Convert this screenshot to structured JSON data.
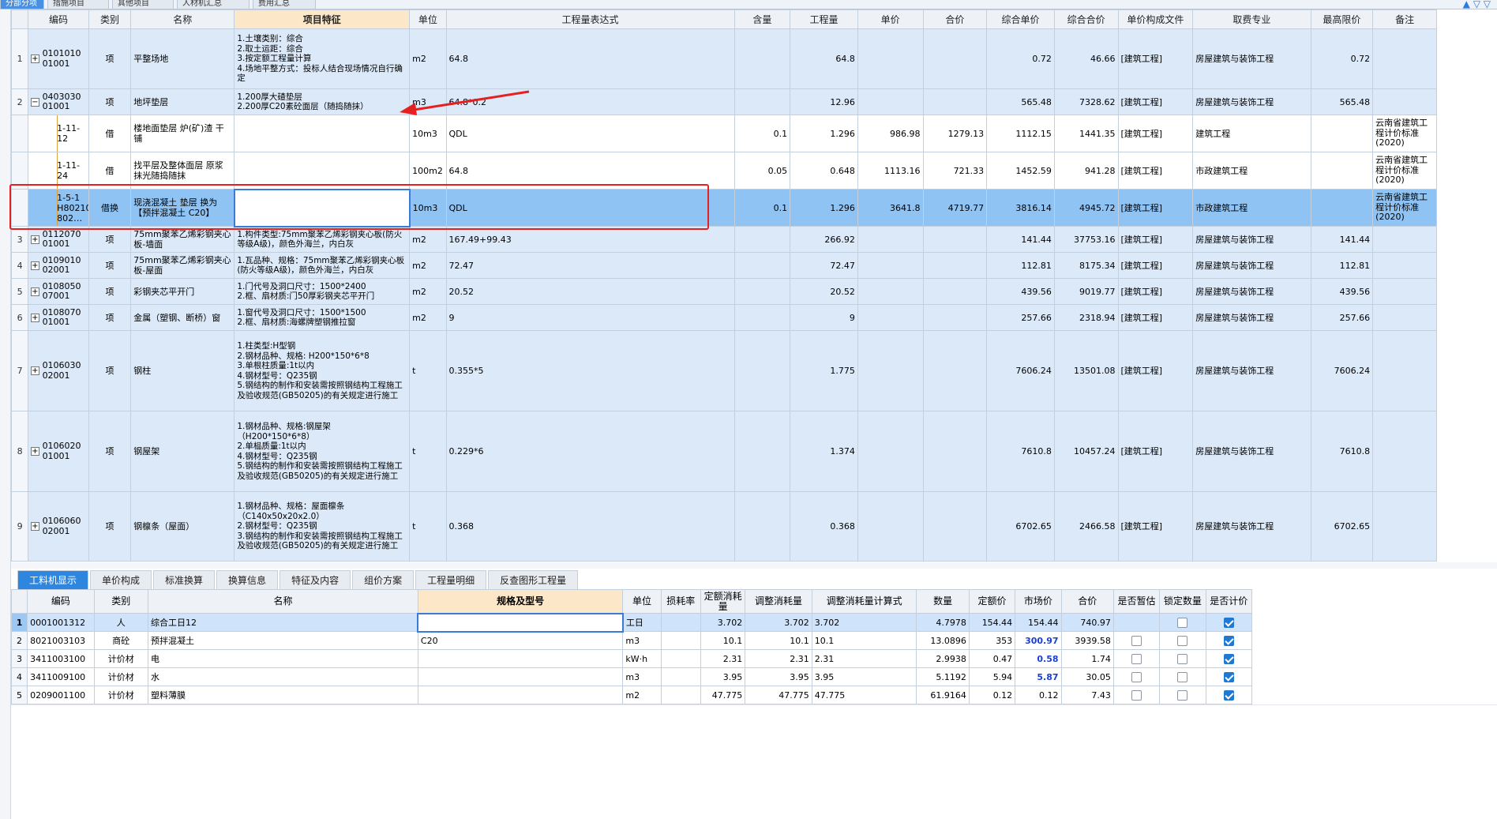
{
  "top_tabs": [
    "分部分项",
    "措施项目",
    "其他项目",
    "人材机汇总",
    "费用汇总"
  ],
  "main_headers": [
    "编码",
    "类别",
    "名称",
    "项目特征",
    "单位",
    "工程量表达式",
    "含量",
    "工程量",
    "单价",
    "合价",
    "综合单价",
    "综合合价",
    "单价构成文件",
    "取费专业",
    "最高限价",
    "备注"
  ],
  "main_rows": [
    {
      "idx": "1",
      "expander": "+",
      "code": "010101001001",
      "type": "项",
      "name": "平整场地",
      "feature": "1.土壤类别：综合\n2.取土运距：综合\n3.按定额工程量计算\n4.场地平整方式：投标人结合现场情况自行确定",
      "unit": "m2",
      "expr": "64.8",
      "content": "",
      "qty": "64.8",
      "uprice": "",
      "total": "",
      "cuprice": "0.72",
      "ctotal": "46.66",
      "file": "[建筑工程]",
      "major": "房屋建筑与装饰工程",
      "maxprice": "0.72",
      "note": ""
    },
    {
      "idx": "2",
      "expander": "−",
      "code": "040303001001",
      "type": "项",
      "name": "地坪垫层",
      "feature": "1.200厚大碴垫层\n2.200厚C20素砼面层（随捣随抹）",
      "unit": "m3",
      "expr": "64.8*0.2",
      "content": "",
      "qty": "12.96",
      "uprice": "",
      "total": "",
      "cuprice": "565.48",
      "ctotal": "7328.62",
      "file": "[建筑工程]",
      "major": "房屋建筑与装饰工程",
      "maxprice": "565.48",
      "note": ""
    },
    {
      "idx": "",
      "expander": "",
      "code": "1-11-12",
      "type": "借",
      "name": "楼地面垫层 炉(矿)渣 干铺",
      "feature": "",
      "unit": "10m3",
      "expr": "QDL",
      "content": "0.1",
      "qty": "1.296",
      "uprice": "986.98",
      "total": "1279.13",
      "cuprice": "1112.15",
      "ctotal": "1441.35",
      "file": "[建筑工程]",
      "major": "建筑工程",
      "maxprice": "",
      "note": "云南省建筑工程计价标准(2020)"
    },
    {
      "idx": "",
      "expander": "",
      "code": "1-11-24",
      "type": "借",
      "name": "找平层及整体面层 原浆抹光随捣随抹",
      "feature": "",
      "unit": "100m2",
      "expr": "64.8",
      "content": "0.05",
      "qty": "0.648",
      "uprice": "1113.16",
      "total": "721.33",
      "cuprice": "1452.59",
      "ctotal": "941.28",
      "file": "[建筑工程]",
      "major": "市政建筑工程",
      "maxprice": "",
      "note": "云南省建筑工程计价标准(2020)"
    },
    {
      "idx": "",
      "expander": "",
      "code": "1-5-1 H8021003102 802…",
      "type": "借换",
      "name": "现浇混凝土 垫层  换为【预拌混凝土 C20】",
      "feature": "",
      "unit": "10m3",
      "expr": "QDL",
      "content": "0.1",
      "qty": "1.296",
      "uprice": "3641.8",
      "total": "4719.77",
      "cuprice": "3816.14",
      "ctotal": "4945.72",
      "file": "[建筑工程]",
      "major": "市政建筑工程",
      "maxprice": "",
      "note": "云南省建筑工程计价标准(2020)"
    },
    {
      "idx": "3",
      "expander": "+",
      "code": "011207001001",
      "type": "项",
      "name": "75mm聚苯乙烯彩钢夹心板-墙面",
      "feature": "1.构件类型:75mm聚苯乙烯彩钢夹心板(防火等级A级)，颜色外海兰，内白灰",
      "unit": "m2",
      "expr": "167.49+99.43",
      "content": "",
      "qty": "266.92",
      "uprice": "",
      "total": "",
      "cuprice": "141.44",
      "ctotal": "37753.16",
      "file": "[建筑工程]",
      "major": "房屋建筑与装饰工程",
      "maxprice": "141.44",
      "note": ""
    },
    {
      "idx": "4",
      "expander": "+",
      "code": "010901002001",
      "type": "项",
      "name": "75mm聚苯乙烯彩钢夹心板-屋面",
      "feature": "1.瓦品种、规格：75mm聚苯乙烯彩钢夹心板(防火等级A级)，颜色外海兰，内白灰",
      "unit": "m2",
      "expr": "72.47",
      "content": "",
      "qty": "72.47",
      "uprice": "",
      "total": "",
      "cuprice": "112.81",
      "ctotal": "8175.34",
      "file": "[建筑工程]",
      "major": "房屋建筑与装饰工程",
      "maxprice": "112.81",
      "note": ""
    },
    {
      "idx": "5",
      "expander": "+",
      "code": "010805007001",
      "type": "项",
      "name": "彩钢夹芯平开门",
      "feature": "1.门代号及洞口尺寸：1500*2400\n2.框、扇材质:门50厚彩钢夹芯平开门",
      "unit": "m2",
      "expr": "20.52",
      "content": "",
      "qty": "20.52",
      "uprice": "",
      "total": "",
      "cuprice": "439.56",
      "ctotal": "9019.77",
      "file": "[建筑工程]",
      "major": "房屋建筑与装饰工程",
      "maxprice": "439.56",
      "note": ""
    },
    {
      "idx": "6",
      "expander": "+",
      "code": "010807001001",
      "type": "项",
      "name": "金属（塑钢、断桥）窗",
      "feature": "1.窗代号及洞口尺寸：1500*1500\n2.框、扇材质:海螺牌塑钢推拉窗",
      "unit": "m2",
      "expr": "9",
      "content": "",
      "qty": "9",
      "uprice": "",
      "total": "",
      "cuprice": "257.66",
      "ctotal": "2318.94",
      "file": "[建筑工程]",
      "major": "房屋建筑与装饰工程",
      "maxprice": "257.66",
      "note": ""
    },
    {
      "idx": "7",
      "expander": "+",
      "code": "010603002001",
      "type": "项",
      "name": "钢柱",
      "feature": "1.柱类型:H型钢\n2.钢材品种、规格: H200*150*6*8\n3.单根柱质量:1t以内\n4.钢材型号：Q235钢\n5.钢结构的制作和安装需按照钢结构工程施工及验收规范(GB50205)的有关规定进行施工",
      "unit": "t",
      "expr": "0.355*5",
      "content": "",
      "qty": "1.775",
      "uprice": "",
      "total": "",
      "cuprice": "7606.24",
      "ctotal": "13501.08",
      "file": "[建筑工程]",
      "major": "房屋建筑与装饰工程",
      "maxprice": "7606.24",
      "note": ""
    },
    {
      "idx": "8",
      "expander": "+",
      "code": "010602001001",
      "type": "项",
      "name": "钢屋架",
      "feature": "1.钢材品种、规格:钢屋架（H200*150*6*8）\n2.单榀质量:1t以内\n4.钢材型号：Q235钢\n5.钢结构的制作和安装需按照钢结构工程施工及验收规范(GB50205)的有关规定进行施工",
      "unit": "t",
      "expr": "0.229*6",
      "content": "",
      "qty": "1.374",
      "uprice": "",
      "total": "",
      "cuprice": "7610.8",
      "ctotal": "10457.24",
      "file": "[建筑工程]",
      "major": "房屋建筑与装饰工程",
      "maxprice": "7610.8",
      "note": ""
    },
    {
      "idx": "9",
      "expander": "+",
      "code": "010606002001",
      "type": "项",
      "name": "钢檩条（屋面）",
      "feature": "1.钢材品种、规格：屋面檩条（C140x50x20x2.0）\n2.钢材型号：Q235钢\n3.钢结构的制作和安装需按照钢结构工程施工及验收规范(GB50205)的有关规定进行施工",
      "unit": "t",
      "expr": "0.368",
      "content": "",
      "qty": "0.368",
      "uprice": "",
      "total": "",
      "cuprice": "6702.65",
      "ctotal": "2466.58",
      "file": "[建筑工程]",
      "major": "房屋建筑与装饰工程",
      "maxprice": "6702.65",
      "note": ""
    }
  ],
  "bottom_tabs": [
    "工料机显示",
    "单价构成",
    "标准换算",
    "换算信息",
    "特征及内容",
    "组价方案",
    "工程量明细",
    "反查图形工程量"
  ],
  "bottom_headers": [
    "编码",
    "类别",
    "名称",
    "规格及型号",
    "单位",
    "损耗率",
    "定额消耗量",
    "调整消耗量",
    "调整消耗量计算式",
    "数量",
    "定额价",
    "市场价",
    "合价",
    "是否暂估",
    "锁定数量",
    "是否计价"
  ],
  "bottom_rows": [
    {
      "idx": "1",
      "code": "0001001312",
      "type": "人",
      "name": "综合工日12",
      "spec": "",
      "unit": "工日",
      "loss": "",
      "quota": "3.702",
      "adj": "3.702",
      "formula": "3.702",
      "qty": "4.7978",
      "qprice": "154.44",
      "mprice": "154.44",
      "total": "740.97"
    },
    {
      "idx": "2",
      "code": "8021003103",
      "type": "商砼",
      "name": "预拌混凝土",
      "spec": "C20",
      "unit": "m3",
      "loss": "",
      "quota": "10.1",
      "adj": "10.1",
      "formula": "10.1",
      "qty": "13.0896",
      "qprice": "353",
      "mprice": "300.97",
      "total": "3939.58"
    },
    {
      "idx": "3",
      "code": "3411003100",
      "type": "计价材",
      "name": "电",
      "spec": "",
      "unit": "kW·h",
      "loss": "",
      "quota": "2.31",
      "adj": "2.31",
      "formula": "2.31",
      "qty": "2.9938",
      "qprice": "0.47",
      "mprice": "0.58",
      "total": "1.74"
    },
    {
      "idx": "4",
      "code": "3411009100",
      "type": "计价材",
      "name": "水",
      "spec": "",
      "unit": "m3",
      "loss": "",
      "quota": "3.95",
      "adj": "3.95",
      "formula": "3.95",
      "qty": "5.1192",
      "qprice": "5.94",
      "mprice": "5.87",
      "total": "30.05"
    },
    {
      "idx": "5",
      "code": "0209001100",
      "type": "计价材",
      "name": "塑料薄膜",
      "spec": "",
      "unit": "m2",
      "loss": "",
      "quota": "47.775",
      "adj": "47.775",
      "formula": "47.775",
      "qty": "61.9164",
      "qprice": "0.12",
      "mprice": "0.12",
      "total": "7.43"
    }
  ],
  "colors": {
    "accent": "#2e86de",
    "row_blue": "#dce9f9",
    "row_selected": "#8ec3f4",
    "highlight_box": "#e62020",
    "market_price": "#1a3fd6"
  }
}
